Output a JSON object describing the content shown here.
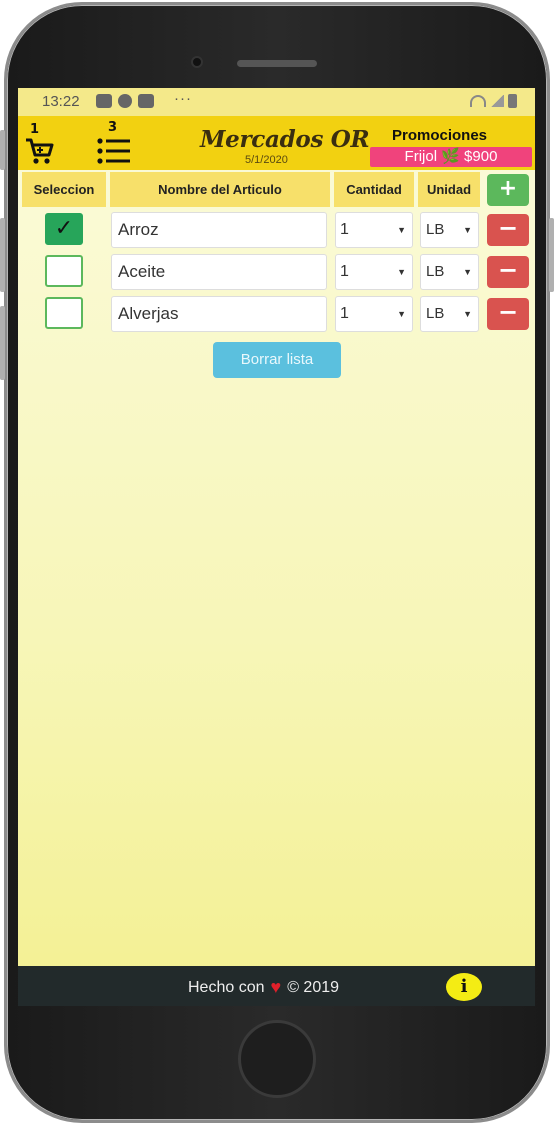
{
  "status_bar": {
    "time": "13:22",
    "dots": "···"
  },
  "app": {
    "cart_count": "1",
    "list_count": "3",
    "title": "Mercados OR",
    "date": "5/1/2020",
    "promo_label": "Promociones",
    "promo_item": "Frijol 🌿 $900"
  },
  "table": {
    "headers": [
      "Seleccion",
      "Nombre del Articulo",
      "Cantidad",
      "Unidad"
    ],
    "add_label": "+",
    "delete_label": "−",
    "rows": [
      {
        "selected": true,
        "name": "Arroz",
        "qty": "1",
        "unit": "LB"
      },
      {
        "selected": false,
        "name": "Aceite",
        "qty": "1",
        "unit": "LB"
      },
      {
        "selected": false,
        "name": "Alverjas",
        "qty": "1",
        "unit": "LB"
      }
    ]
  },
  "clear_button": "Borrar lista",
  "footer": {
    "made_with": "Hecho con",
    "copyright": "© 2019"
  },
  "icons": [
    "cart-icon",
    "list-icon",
    "check-icon",
    "heart-icon",
    "info-icon"
  ],
  "colors": {
    "appbar": "#f2d111",
    "promo": "#f0437c",
    "add": "#5cb85c",
    "delete": "#d9534f",
    "clear": "#5bc0de",
    "footer": "#222a2b"
  }
}
